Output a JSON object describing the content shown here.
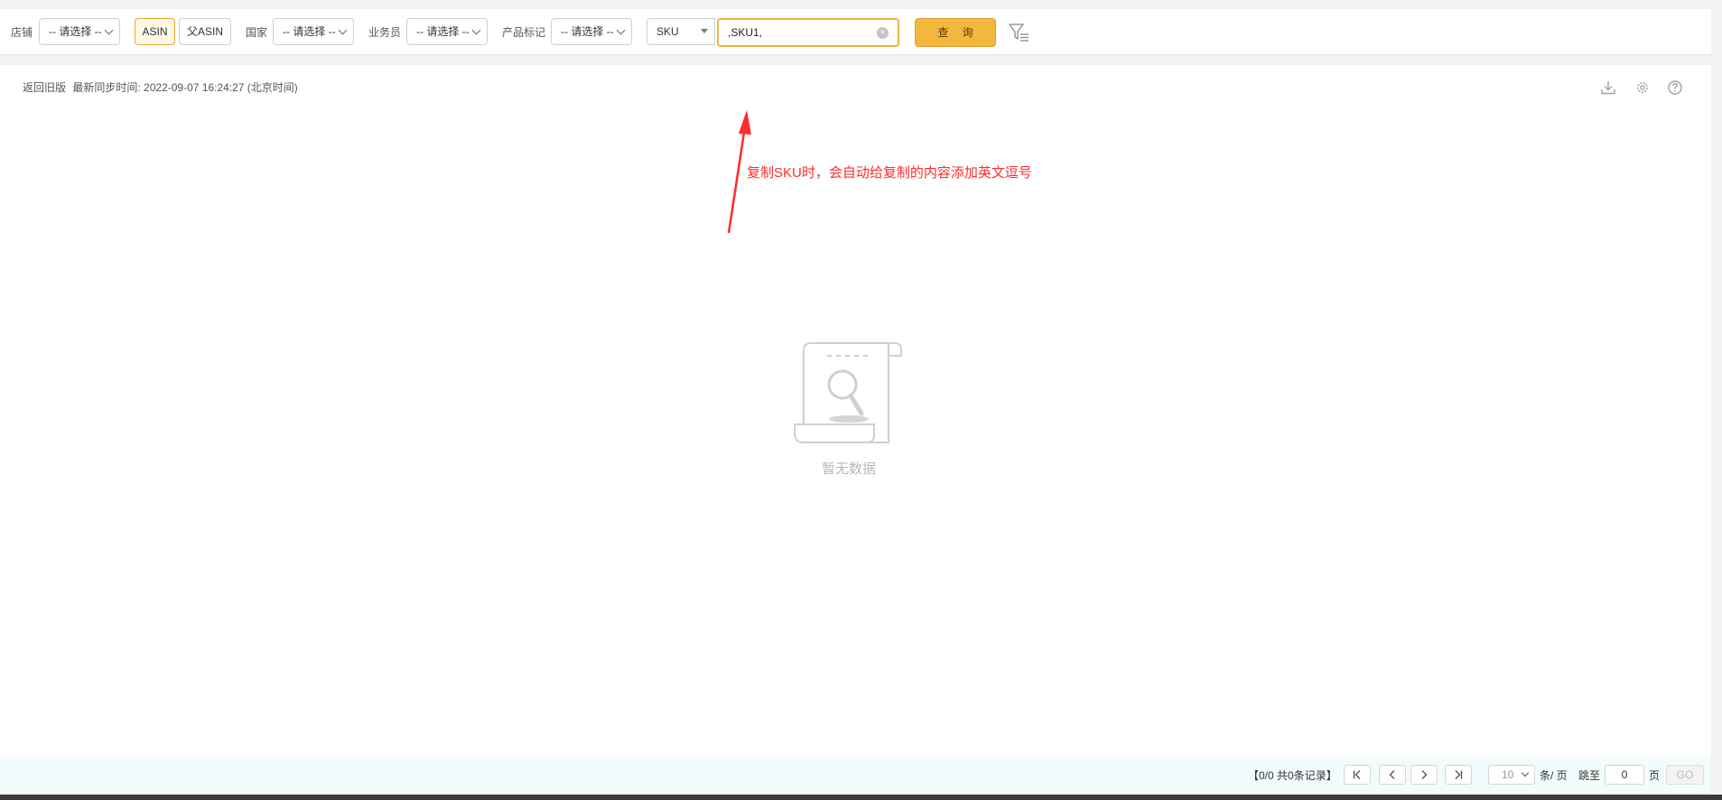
{
  "filters": {
    "store_label": "店铺",
    "store_value": "-- 请选择 --",
    "asin_toggle": {
      "asin_label": "ASIN",
      "parent_asin_label": "父ASIN",
      "active": "ASIN"
    },
    "country_label": "国家",
    "country_value": "-- 请选择 --",
    "salesperson_label": "业务员",
    "salesperson_value": "-- 请选择 --",
    "product_tag_label": "产品标记",
    "product_tag_value": "-- 请选择 --",
    "search_type_value": "SKU",
    "search_input_value": ",SKU1,",
    "query_button": "查 询"
  },
  "header": {
    "back_link": "返回旧版",
    "sync_label": "最新同步时间:",
    "sync_time": "2022-09-07 16:24:27 (北京时间)"
  },
  "annotation": {
    "text": "复制SKU时，会自动给复制的内容添加英文逗号",
    "color": "#ff2b2b"
  },
  "empty_state": {
    "text": "暂无数据"
  },
  "pagination": {
    "info": "【0/0  共0条记录】",
    "page_size_value": "10",
    "per_page_label": "条/ 页",
    "jump_label": "跳至",
    "jump_value": "0",
    "page_unit": "页",
    "go_label": "GO"
  },
  "icons": {
    "filter": "filter-icon",
    "download": "download-icon",
    "settings": "gear-icon",
    "help": "help-icon",
    "clear": "clear-icon"
  },
  "colors": {
    "accent": "#f4b73e",
    "accent_border": "#e9a92c"
  }
}
